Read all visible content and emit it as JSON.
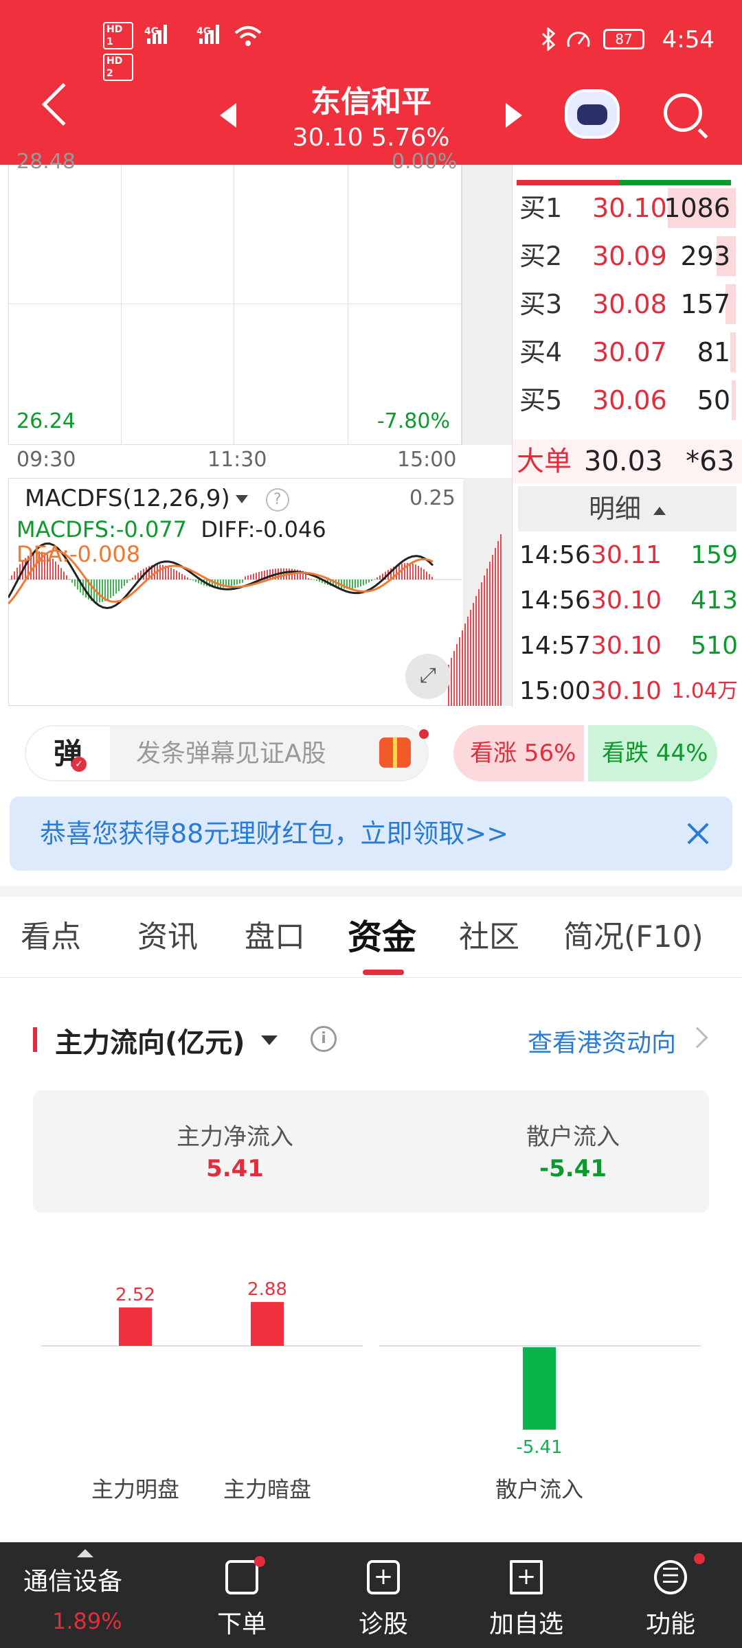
{
  "status_bar": {
    "hd1": "HD 1",
    "hd2": "HD 2",
    "net": "4G",
    "battery": "87",
    "time": "4:54"
  },
  "header": {
    "stock_name": "东信和平",
    "price": "30.10",
    "change_pct": "5.76%"
  },
  "intraday": {
    "top_left_cut": "28.48",
    "top_right_cut": "0.00%",
    "low_price": "26.24",
    "low_pct": "-7.80%",
    "time_start": "09:30",
    "time_mid": "11:30",
    "time_end": "15:00"
  },
  "macd": {
    "title": "MACDFS(12,26,9)",
    "max": "0.25",
    "macdfs": "MACDFS:-0.077",
    "diff": "DIFF:-0.046",
    "dea": "DEA:-0.008",
    "expand_icon": "expand-icon"
  },
  "orderbook": {
    "bids": [
      {
        "label": "买1",
        "price": "30.10",
        "volume": "1086",
        "bar_fraction": 0.9
      },
      {
        "label": "买2",
        "price": "30.09",
        "volume": "293",
        "bar_fraction": 0.25
      },
      {
        "label": "买3",
        "price": "30.08",
        "volume": "157",
        "bar_fraction": 0.14
      },
      {
        "label": "买4",
        "price": "30.07",
        "volume": "81",
        "bar_fraction": 0.07
      },
      {
        "label": "买5",
        "price": "30.06",
        "volume": "50",
        "bar_fraction": 0.05
      }
    ],
    "big_order": {
      "label": "大单",
      "price": "30.03",
      "volume": "*63"
    },
    "detail_label": "明细",
    "ticks": [
      {
        "time": "14:56",
        "price": "30.11",
        "volume": "159",
        "color": "#0b9b2d"
      },
      {
        "time": "14:56",
        "price": "30.10",
        "volume": "413",
        "color": "#0b9b2d"
      },
      {
        "time": "14:57",
        "price": "30.10",
        "volume": "510",
        "color": "#0b9b2d"
      },
      {
        "time": "15:00",
        "price": "30.10",
        "volume": "1.04万",
        "color": "#e12d3c"
      }
    ]
  },
  "danmu": {
    "key": "弹",
    "placeholder": "发条弹幕见证A股",
    "vote_up": "看涨 56%",
    "vote_down": "看跌 44%"
  },
  "promo": {
    "text": "恭喜您获得88元理财红包，立即领取>>"
  },
  "tabs": [
    {
      "label": "看点",
      "active": false
    },
    {
      "label": "资讯",
      "active": false
    },
    {
      "label": "盘口",
      "active": false
    },
    {
      "label": "资金",
      "active": true
    },
    {
      "label": "社区",
      "active": false
    },
    {
      "label": "简况(F10)",
      "active": false
    }
  ],
  "fund_flow": {
    "title": "主力流向(亿元)",
    "hk_link": "查看港资动向",
    "summary": [
      {
        "label": "主力净流入",
        "value": "5.41",
        "color": "#e12d3c"
      },
      {
        "label": "散户流入",
        "value": "-5.41",
        "color": "#0b9b2d"
      }
    ]
  },
  "chart_data": {
    "type": "bar",
    "title": "",
    "categories": [
      "主力明盘",
      "主力暗盘",
      "散户流入"
    ],
    "values": [
      2.52,
      2.88,
      -5.41
    ],
    "value_labels": [
      "2.52",
      "2.88",
      "-5.41"
    ],
    "colors": {
      "positive": "#f0303c",
      "negative": "#09b54a"
    },
    "ylim": [
      -5.41,
      2.88
    ]
  },
  "bottom_nav": {
    "sector": "通信设备",
    "sector_pct": "1.89%",
    "items": [
      {
        "label": "下单",
        "icon": "order-icon",
        "dot": true
      },
      {
        "label": "诊股",
        "icon": "diagnose-icon",
        "dot": false
      },
      {
        "label": "加自选",
        "icon": "add-watchlist-icon",
        "dot": false
      },
      {
        "label": "功能",
        "icon": "menu-icon",
        "dot": true
      }
    ]
  }
}
